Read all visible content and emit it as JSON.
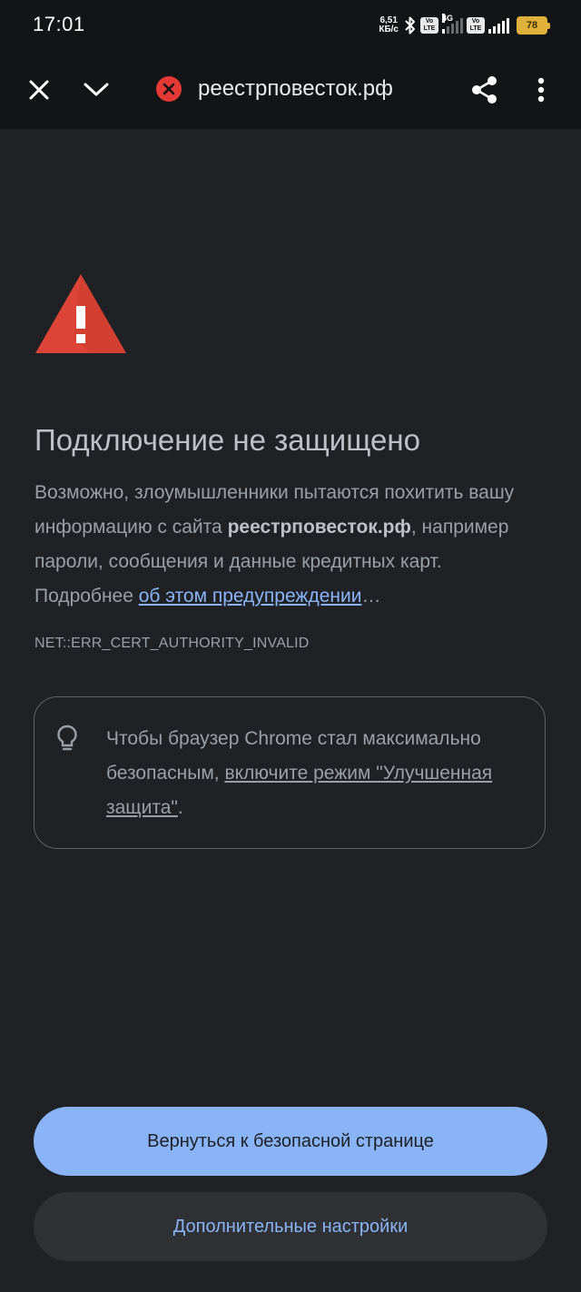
{
  "status_bar": {
    "time": "17:01",
    "net_speed_value": "6,51",
    "net_speed_unit": "КБ/с",
    "volte1": "Vo LTE",
    "net_type": "4G",
    "volte2": "Vo LTE",
    "battery_level": "78",
    "battery_color": "#e0b13a"
  },
  "toolbar": {
    "url": "реестрповесток.рф",
    "security_icon": "error-x-icon"
  },
  "interstitial": {
    "title": "Подключение не защищено",
    "message_part1": "Возможно, злоумышленники пытаются похитить вашу информацию с сайта ",
    "message_domain": "реестрповесток.рф",
    "message_part2": ", например пароли, сообщения и данные кредитных карт. Подробнее ",
    "message_link": "об этом предупреждении",
    "message_ellipsis": "…",
    "error_code": "NET::ERR_CERT_AUTHORITY_INVALID"
  },
  "tip": {
    "icon": "lightbulb-icon",
    "text_part1": "Чтобы браузер Chrome стал максимально безопасным, ",
    "link": "включите режим \"Улучшенная защита\"",
    "text_part2": "."
  },
  "buttons": {
    "back_to_safety": "Вернуться к безопасной странице",
    "advanced": "Дополнительные настройки"
  },
  "colors": {
    "background": "#202124",
    "primary_button": "#8ab4f8",
    "secondary_button": "#303134",
    "warning_red": "#db4437"
  }
}
